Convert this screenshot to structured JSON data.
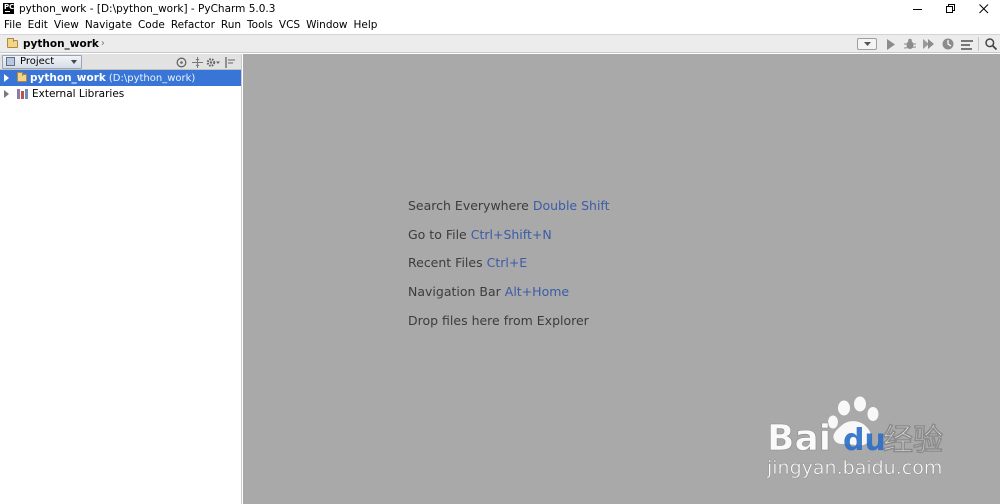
{
  "window": {
    "title": "python_work - [D:\\python_work] - PyCharm 5.0.3"
  },
  "menu": {
    "items": [
      "File",
      "Edit",
      "View",
      "Navigate",
      "Code",
      "Refactor",
      "Run",
      "Tools",
      "VCS",
      "Window",
      "Help"
    ]
  },
  "navbar": {
    "project_name": "python_work"
  },
  "project_panel": {
    "tab_label": "Project",
    "tree": [
      {
        "label": "python_work",
        "path": "(D:\\python_work)",
        "selected": true
      },
      {
        "label": "External Libraries",
        "path": "",
        "selected": false
      }
    ]
  },
  "editor": {
    "hints": [
      {
        "text": "Search Everywhere",
        "shortcut": "Double Shift"
      },
      {
        "text": "Go to File",
        "shortcut": "Ctrl+Shift+N"
      },
      {
        "text": "Recent Files",
        "shortcut": "Ctrl+E"
      },
      {
        "text": "Navigation Bar",
        "shortcut": "Alt+Home"
      },
      {
        "text": "Drop files here from Explorer",
        "shortcut": ""
      }
    ]
  },
  "watermark": {
    "brand_latin": "Bai",
    "brand_du": "du",
    "brand_cn": "经验",
    "url": "jingyan.baidu.com"
  },
  "colors": {
    "editor_bg": "#a9a9a9",
    "selection": "#3875d7",
    "shortcut_text": "#3b5ca8",
    "hint_text": "#3c3c3c"
  },
  "icons": {
    "run": "run-icon",
    "debug": "debug-icon",
    "coverage": "coverage-icon",
    "profile": "profile-icon",
    "tasks": "tasks-icon",
    "search": "search-icon"
  }
}
